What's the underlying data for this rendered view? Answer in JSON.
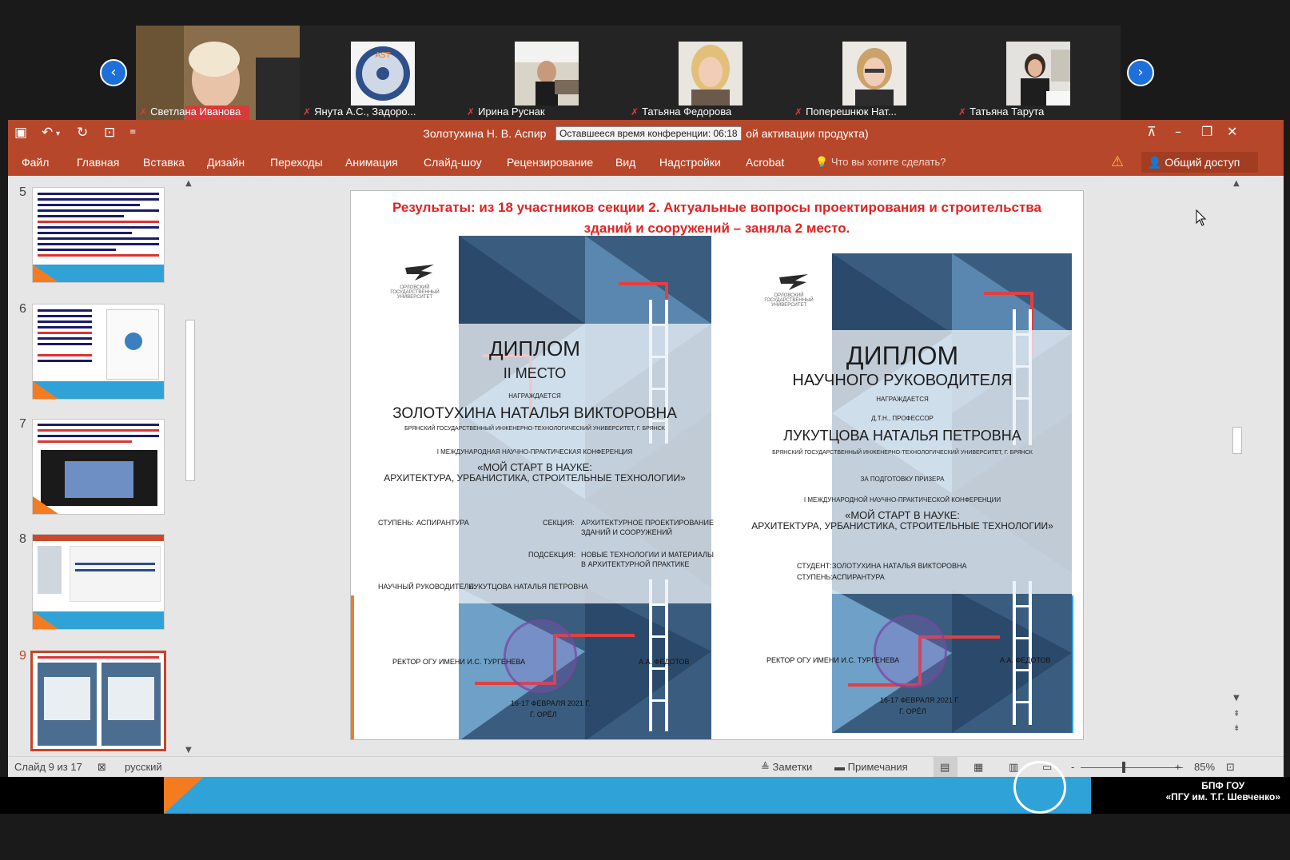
{
  "participants": [
    {
      "name": "Светлана Иванова"
    },
    {
      "name": "Янута А.С., Задоро..."
    },
    {
      "name": "Ирина Руснак"
    },
    {
      "name": "Татьяна Федорова"
    },
    {
      "name": "Поперешнюк Нат..."
    },
    {
      "name": "Татьяна Тарута"
    }
  ],
  "nav": {
    "prev_icon": "chevron-left-icon",
    "next_icon": "chevron-right-icon"
  },
  "window": {
    "title": "Золотухина Н. В. Аспир",
    "title_tail": "06:18",
    "title_suffix": "ой активации продукта)",
    "tooltip": "Оставшееся время конференции: 06:18"
  },
  "ribbon": {
    "tabs": [
      "Файл",
      "Главная",
      "Вставка",
      "Дизайн",
      "Переходы",
      "Анимация",
      "Слайд-шоу",
      "Рецензирование",
      "Вид",
      "Надстройки",
      "Acrobat"
    ],
    "tell_me": "Что вы хотите сделать?",
    "share": "Общий доступ"
  },
  "thumbnails": [
    {
      "number": "5",
      "selected": false
    },
    {
      "number": "6",
      "selected": false
    },
    {
      "number": "7",
      "selected": false
    },
    {
      "number": "8",
      "selected": false
    },
    {
      "number": "9",
      "selected": true
    }
  ],
  "slide": {
    "heading_line1": "Результаты: из 18 участников секции 2. Актуальные вопросы проектирования и строительства",
    "heading_line2": "зданий и сооружений – заняла 2 место.",
    "diploma1": {
      "university": "ОРЛОВСКИЙ ГОСУДАРСТВЕННЫЙ УНИВЕРСИТЕТ",
      "title": "ДИПЛОМ",
      "place": "II МЕСТО",
      "awarded": "НАГРАЖДАЕТСЯ",
      "name": "ЗОЛОТУХИНА НАТАЛЬЯ ВИКТОРОВНА",
      "org": "БРЯНСКИЙ ГОСУДАРСТВЕННЫЙ ИНЖЕНЕРНО-ТЕХНОЛОГИЧЕСКИЙ УНИВЕРСИТЕТ, Г. БРЯНСК",
      "conf": "I МЕЖДУНАРОДНАЯ НАУЧНО-ПРАКТИЧЕСКАЯ КОНФЕРЕНЦИЯ",
      "conf_title1": "«МОЙ СТАРТ В НАУКЕ:",
      "conf_title2": "АРХИТЕКТУРА, УРБАНИСТИКА, СТРОИТЕЛЬНЫЕ ТЕХНОЛОГИИ»",
      "level_label": "СТУПЕНЬ:",
      "level_value": "АСПИРАНТУРА",
      "section_label": "СЕКЦИЯ:",
      "section_value1": "АРХИТЕКТУРНОЕ ПРОЕКТИРОВАНИЕ",
      "section_value2": "ЗДАНИЙ И СООРУЖЕНИЙ",
      "subsection_label": "ПОДСЕКЦИЯ:",
      "subsection_value1": "НОВЫЕ ТЕХНОЛОГИИ И МАТЕРИАЛЫ",
      "subsection_value2": "В АРХИТЕКТУРНОЙ ПРАКТИКЕ",
      "advisor_label": "НАУЧНЫЙ РУКОВОДИТЕЛЬ:",
      "advisor_value": "ЛУКУТЦОВА НАТАЛЬЯ ПЕТРОВНА",
      "rector": "РЕКТОР ОГУ ИМЕНИ И.С. ТУРГЕНЕВА",
      "rector_sign": "А.А. ФЕДОТОВ",
      "date": "16-17 ФЕВРАЛЯ 2021 Г.",
      "city": "Г. ОРЁЛ"
    },
    "diploma2": {
      "university": "ОРЛОВСКИЙ ГОСУДАРСТВЕННЫЙ УНИВЕРСИТЕТ",
      "title": "ДИПЛОМ",
      "subtitle": "НАУЧНОГО РУКОВОДИТЕЛЯ",
      "awarded": "НАГРАЖДАЕТСЯ",
      "degree": "Д.Т.Н., ПРОФЕССОР",
      "name": "ЛУКУТЦОВА НАТАЛЬЯ ПЕТРОВНА",
      "org": "БРЯНСКИЙ ГОСУДАРСТВЕННЫЙ ИНЖЕНЕРНО-ТЕХНОЛОГИЧЕСКИЙ УНИВЕРСИТЕТ, Г. БРЯНСК",
      "for": "ЗА ПОДГОТОВКУ ПРИЗЕРА",
      "conf": "I МЕЖДУНАРОДНОЙ НАУЧНО-ПРАКТИЧЕСКОЙ КОНФЕРЕНЦИИ",
      "conf_title1": "«МОЙ СТАРТ В НАУКЕ:",
      "conf_title2": "АРХИТЕКТУРА, УРБАНИСТИКА, СТРОИТЕЛЬНЫЕ ТЕХНОЛОГИИ»",
      "student_label": "СТУДЕНТ:",
      "student_value": "ЗОЛОТУХИНА НАТАЛЬЯ ВИКТОРОВНА",
      "level_label": "СТУПЕНЬ:",
      "level_value": "АСПИРАНТУРА",
      "rector": "РЕКТОР ОГУ ИМЕНИ И.С. ТУРГЕНЕВА",
      "rector_sign": "А.А. ФЕДОТОВ",
      "date": "16-17 ФЕВРАЛЯ 2021 Г.",
      "city": "Г. ОРЁЛ"
    }
  },
  "statusbar": {
    "slide": "Слайд 9 из 17",
    "language": "русский",
    "notes": "Заметки",
    "comments": "Примечания",
    "zoom_minus": "-",
    "zoom_plus": "+",
    "zoom": "85%"
  },
  "watermark": {
    "line1": "БПФ ГОУ",
    "line2": "«ПГУ им. Т.Г. Шевченко»"
  },
  "colors": {
    "ppt_red": "#b7472a",
    "accent_blue": "#2fa3d7",
    "accent_orange": "#f47b20",
    "heading_red": "#e22222"
  }
}
